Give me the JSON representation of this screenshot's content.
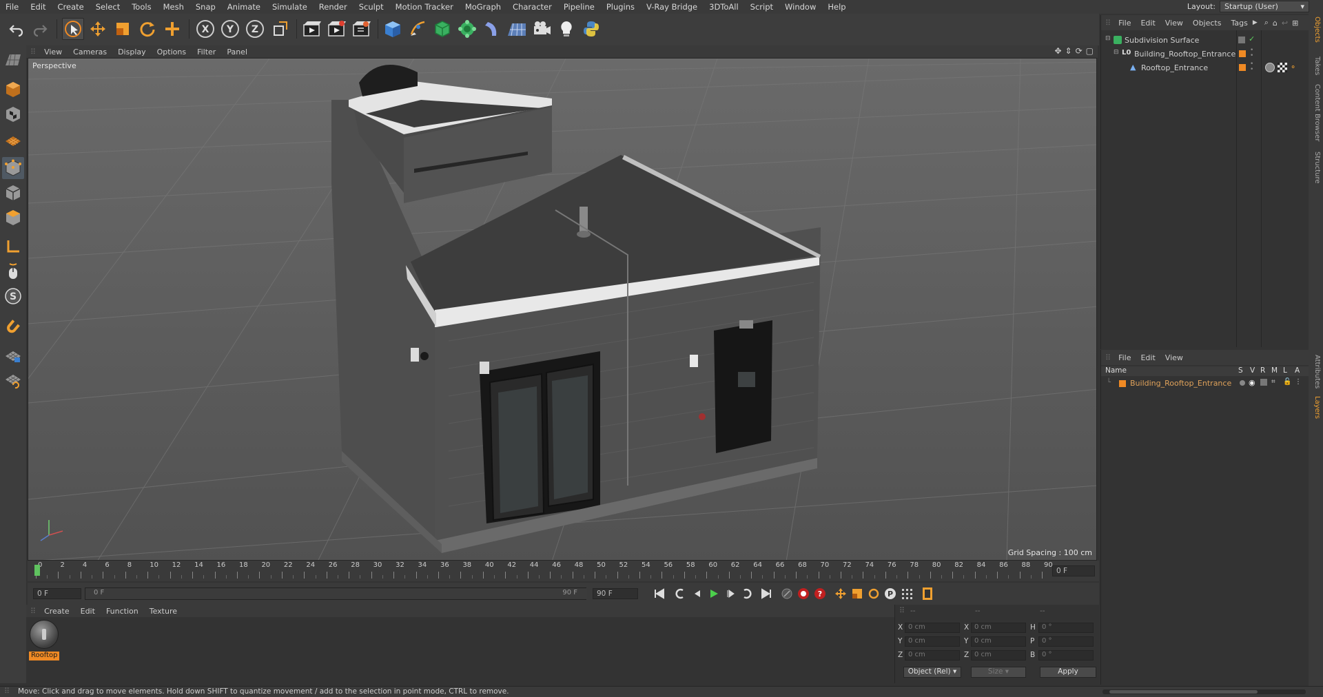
{
  "menu": [
    "File",
    "Edit",
    "Create",
    "Select",
    "Tools",
    "Mesh",
    "Snap",
    "Animate",
    "Simulate",
    "Render",
    "Sculpt",
    "Motion Tracker",
    "MoGraph",
    "Character",
    "Pipeline",
    "Plugins",
    "V-Ray Bridge",
    "3DToAll",
    "Script",
    "Window",
    "Help"
  ],
  "layout": {
    "label": "Layout:",
    "value": "Startup (User)"
  },
  "toolbar_icons": [
    "undo-icon",
    "redo-icon",
    "live-selection-icon",
    "move-icon",
    "scale-icon",
    "rotate-icon",
    "add-icon",
    "x-axis-icon",
    "y-axis-icon",
    "z-axis-icon",
    "coordinate-system-icon",
    "render-view-icon",
    "render-picture-viewer-icon",
    "edit-render-settings-icon",
    "cube-icon",
    "pen-icon",
    "subdivision-icon",
    "cloner-icon",
    "deformer-icon",
    "floor-icon",
    "camera-icon",
    "light-icon",
    "python-icon"
  ],
  "viewport": {
    "menu": [
      "View",
      "Cameras",
      "Display",
      "Options",
      "Filter",
      "Panel"
    ],
    "label": "Perspective",
    "grid_spacing": "Grid Spacing : 100 cm"
  },
  "timeline": {
    "ticks": [
      "0",
      "2",
      "4",
      "6",
      "8",
      "10",
      "12",
      "14",
      "16",
      "18",
      "20",
      "22",
      "24",
      "26",
      "28",
      "30",
      "32",
      "34",
      "36",
      "38",
      "40",
      "42",
      "44",
      "46",
      "48",
      "50",
      "52",
      "54",
      "56",
      "58",
      "60",
      "62",
      "64",
      "66",
      "68",
      "70",
      "72",
      "74",
      "76",
      "78",
      "80",
      "82",
      "84",
      "86",
      "88",
      "90"
    ],
    "current_frame": "0 F",
    "start_field": "0 F",
    "range_start": "0 F",
    "range_end": "90 F",
    "end_field": "90 F"
  },
  "material_manager": {
    "menu": [
      "Create",
      "Edit",
      "Function",
      "Texture"
    ],
    "material_name": "Rooftop"
  },
  "coordinates": {
    "headers": [
      "--",
      "--",
      "--"
    ],
    "rows": [
      {
        "a": "X",
        "av": "0 cm",
        "b": "X",
        "bv": "0 cm",
        "c": "H",
        "cv": "0 °"
      },
      {
        "a": "Y",
        "av": "0 cm",
        "b": "Y",
        "bv": "0 cm",
        "c": "P",
        "cv": "0 °"
      },
      {
        "a": "Z",
        "av": "0 cm",
        "b": "Z",
        "bv": "0 cm",
        "c": "B",
        "cv": "0 °"
      }
    ],
    "mode": "Object (Rel)",
    "size": "Size",
    "apply": "Apply"
  },
  "status": "Move: Click and drag to move elements. Hold down SHIFT to quantize movement / add to the selection in point mode, CTRL to remove.",
  "object_manager": {
    "menu": [
      "File",
      "Edit",
      "View",
      "Objects",
      "Tags"
    ],
    "objects": [
      {
        "name": "Subdivision Surface"
      },
      {
        "name": "Building_Rooftop_Entrance"
      },
      {
        "name": "Rooftop_Entrance"
      }
    ]
  },
  "layers_manager": {
    "menu": [
      "File",
      "Edit",
      "View"
    ],
    "columns": [
      "Name",
      "S",
      "V",
      "R",
      "M",
      "L",
      "A"
    ],
    "layer": "Building_Rooftop_Entrance"
  },
  "right_tabs": [
    "Objects",
    "Takes",
    "Content Browser",
    "Structure",
    "Attributes",
    "Layers"
  ],
  "colors": {
    "accent": "#f08a24",
    "highlight": "#e0a25a",
    "active": "#4f5963"
  }
}
